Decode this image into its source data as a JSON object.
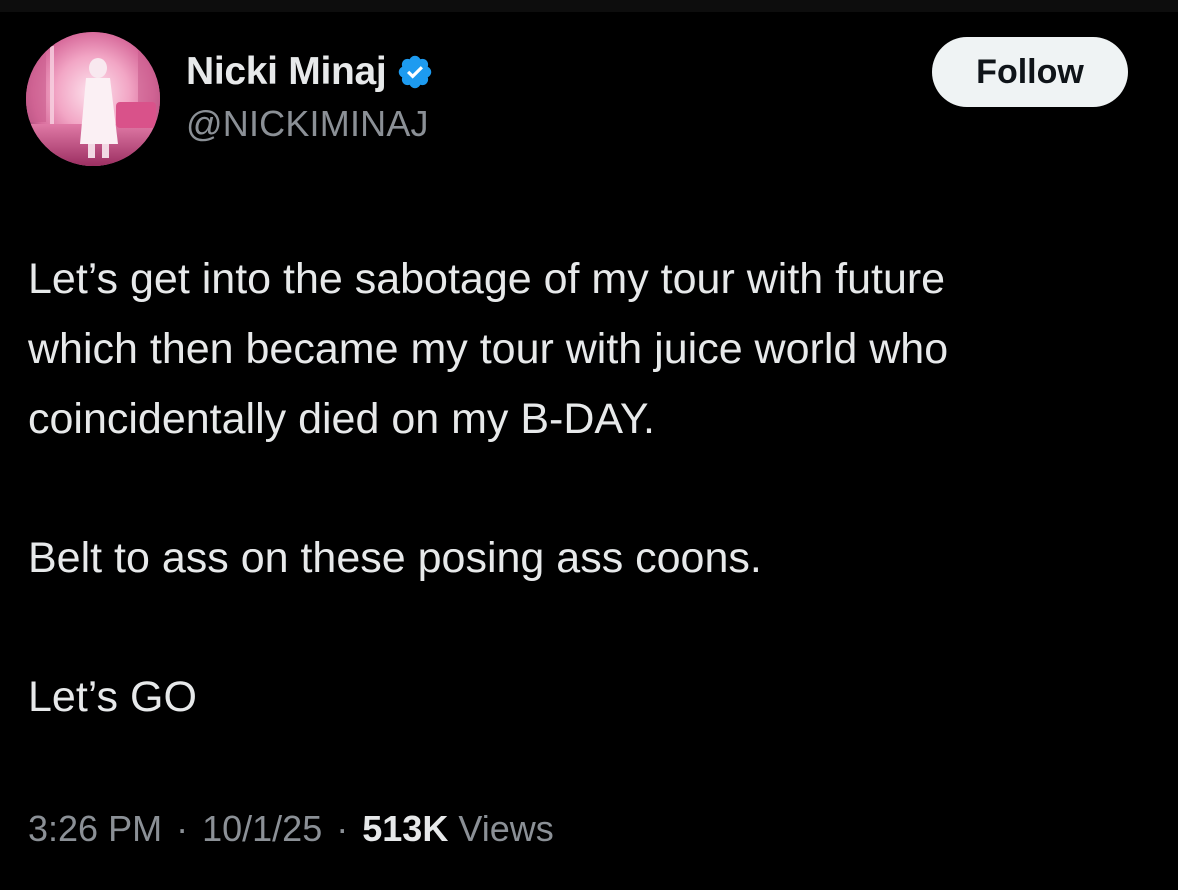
{
  "author": {
    "display_name": "Nicki Minaj",
    "handle": "@NICKIMINAJ",
    "verified": true,
    "verified_icon": "verified-badge-icon",
    "avatar": "profile-avatar"
  },
  "follow_button": {
    "label": "Follow"
  },
  "tweet": {
    "paragraph1": {
      "line1": "Let’s get into the sabotage of my tour with future",
      "line2": "which then became my tour with juice world who",
      "line3": "coincidentally died on my B-DAY."
    },
    "paragraph2": "Belt to ass on these posing ass coons.",
    "paragraph3": "Let’s GO"
  },
  "meta": {
    "time": "3:26 PM",
    "date": "10/1/25",
    "separator": "·",
    "views_count": "513K",
    "views_label": "Views"
  },
  "colors": {
    "background": "#000000",
    "text_primary": "#e7e9ea",
    "text_secondary": "#8b9096",
    "verified_blue": "#1d9bf0",
    "follow_bg": "#eff3f4"
  }
}
